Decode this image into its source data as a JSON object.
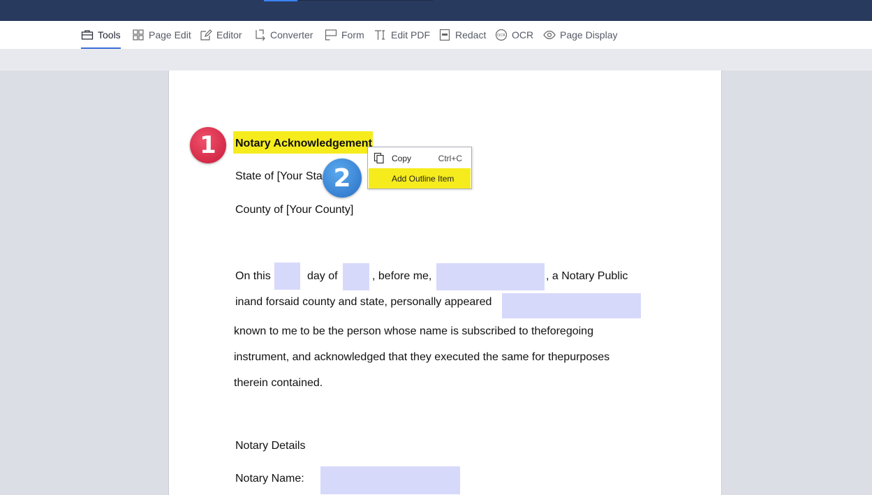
{
  "toolbar": {
    "items": [
      {
        "label": "Tools",
        "icon": "toolbox-icon"
      },
      {
        "label": "Page Edit",
        "icon": "grid-icon"
      },
      {
        "label": "Editor",
        "icon": "edit-icon"
      },
      {
        "label": "Converter",
        "icon": "convert-icon"
      },
      {
        "label": "Form",
        "icon": "form-icon"
      },
      {
        "label": "Edit PDF",
        "icon": "text-cursor-icon"
      },
      {
        "label": "Redact",
        "icon": "redact-icon"
      },
      {
        "label": "OCR",
        "icon": "ocr-icon"
      },
      {
        "label": "Page Display",
        "icon": "eye-icon"
      }
    ],
    "active": "Tools"
  },
  "document": {
    "title": "Notary Acknowledgement",
    "state_line": "State of [Your Sta",
    "county_line": "County of [Your County]",
    "line1": {
      "on_this": "On this",
      "day_of": "day of",
      "before_me": ", before me,",
      "notary_public": ", a Notary Public"
    },
    "line2": "inand forsaid county and state, personally appeared",
    "line3": "known to me to be the person whose name is subscribed to theforegoing",
    "line4": "instrument, and acknowledged that they executed the same for thepurposes",
    "line5": "therein contained.",
    "details_heading": "Notary Details",
    "notary_name_label": "Notary Name:"
  },
  "context_menu": {
    "copy_label": "Copy",
    "copy_shortcut": "Ctrl+C",
    "add_outline_label": "Add Outline Item"
  },
  "badges": {
    "step1": "1",
    "step2": "2"
  },
  "colors": {
    "titlebar": "#283a5e",
    "highlight": "#f6ec1d",
    "form_field": "#d7d9fb",
    "active_underline": "#3a6fd8",
    "badge_red": "#d6263f",
    "badge_blue": "#3a86d6"
  }
}
